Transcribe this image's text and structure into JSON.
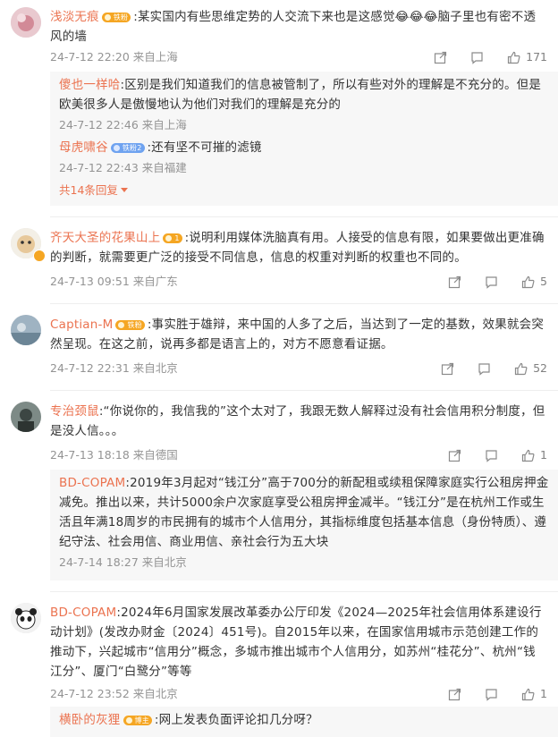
{
  "comments": [
    {
      "user": "浅淡无痕",
      "badge": "铁粉",
      "text": ":某实国内有些思维定势的人交流下来也是这感觉😂😂😂脑子里也有密不透风的墙",
      "meta": "24-7-12 22:20 来自上海",
      "likes": "171",
      "replies": [
        {
          "user": "傻也一样哈",
          "text": ":区别是我们知道我们的信息被管制了，所以有些对外的理解是不充分的。但是欧美很多人是傲慢地认为他们对我们的理解是充分的",
          "meta": "24-7-12 22:46 来自上海"
        },
        {
          "user": "母虎啸谷",
          "badge": "铁粉2",
          "text": ":还有坚不可摧的滤镜",
          "meta": "24-7-12 22:43 来自福建"
        }
      ],
      "more": "共14条回复"
    },
    {
      "user": "齐天大圣的花果山上",
      "badge": "1",
      "text": ":说明利用媒体洗脑真有用。人接受的信息有限，如果要做出更准确的判断，就需要更广泛的接受不同信息，信息的权重对判断的权重也不同的。",
      "meta": "24-7-13 09:51 来自广东",
      "likes": "5"
    },
    {
      "user": "Captian-M",
      "badge": "铁粉",
      "text": ":事实胜于雄辩，来中国的人多了之后，当达到了一定的基数，效果就会突然呈现。在这之前，说再多都是语言上的，对方不愿意看证据。",
      "meta": "24-7-12 22:31 来自北京",
      "likes": "52"
    },
    {
      "user": "专治颈鼠",
      "text": ":“你说你的，我信我的”这个太对了，我跟无数人解释过没有社会信用积分制度，但是没人信。。。",
      "meta": "24-7-13 18:18 来自德国",
      "likes": "1",
      "replies": [
        {
          "user": "BD-COPAM",
          "text": ":2019年3月起对“钱江分”高于700分的新配租或续租保障家庭实行公租房押金减免。推出以来，共计5000余户次家庭享受公租房押金减半。“钱江分”是在杭州工作或生活且年满18周岁的市民拥有的城市个人信用分，其指标维度包括基本信息（身份特质）、遵纪守法、社会用信、商业用信、亲社会行为五大块",
          "meta": "24-7-14 18:27 来自北京"
        }
      ]
    },
    {
      "user": "BD-COPAM",
      "text": ":2024年6月国家发展改革委办公厅印发《2024—2025年社会信用体系建设行动计划》(发改办财金〔2024〕451号)。自2015年以来，在国家信用城市示范创建工作的推动下，兴起城市“信用分”概念，多城市推出城市个人信用分，如苏州“桂花分”、杭州“钱江分”、厦门“白鹭分”等等",
      "meta": "24-7-12 23:52 来自北京",
      "likes": "1",
      "replies": [
        {
          "user": "横卧的灰狸",
          "badge": "博主",
          "text": ":网上发表负面评论扣几分呀？",
          "meta": ""
        }
      ]
    }
  ],
  "icons": [
    "share-icon",
    "comment-icon",
    "like-icon"
  ],
  "colors": {
    "username": "#eb7350",
    "meta": "#939393",
    "reply_bg": "#f7f7f7"
  }
}
